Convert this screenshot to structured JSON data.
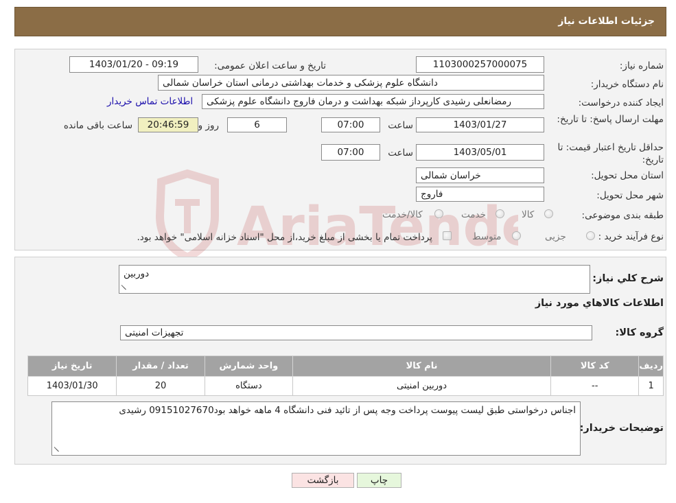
{
  "header": {
    "title": "جزئیات اطلاعات نیاز"
  },
  "details": {
    "need_number_label": "شماره نیاز:",
    "need_number": "1103000257000075",
    "announce_label": "تاریخ و ساعت اعلان عمومی:",
    "announce_value": "1403/01/20 - 09:19",
    "buyer_org_label": "نام دستگاه خریدار:",
    "buyer_org": "دانشگاه علوم پزشکی و خدمات بهداشتی درمانی استان خراسان شمالی",
    "creator_label": "ایجاد کننده درخواست:",
    "creator": "رمضانعلی رشیدی کارپرداز شبکه بهداشت و درمان فاروج دانشگاه علوم پزشکی",
    "contact_link": "اطلاعات تماس خریدار",
    "deadline_label": "مهلت ارسال پاسخ: تا تاریخ:",
    "deadline_date": "1403/01/27",
    "time_label": "ساعت",
    "deadline_time": "07:00",
    "days_value": "6",
    "days_label": "روز و",
    "remaining_time": "20:46:59",
    "remaining_label": "ساعت باقی مانده",
    "validity_label": "حداقل تاریخ اعتبار قیمت: تا تاریخ:",
    "validity_date": "1403/05/01",
    "validity_time_label": "ساعت",
    "validity_time": "07:00",
    "province_label": "استان محل تحویل:",
    "province": "خراسان شمالی",
    "city_label": "شهر محل تحویل:",
    "city": "فاروج",
    "category_label": "طبقه بندی موضوعی:",
    "category_options": [
      "کالا",
      "خدمت",
      "کالا/خدمت"
    ],
    "process_label": "نوع فرآیند خرید :",
    "process_options": [
      "جزیی",
      "متوسط"
    ],
    "process_note": "پرداخت تمام یا بخشی از مبلغ خرید،از محل \"اسناد خزانه اسلامی\" خواهد بود."
  },
  "description": {
    "label": "شرح کلي نياز:",
    "value": "دوربین",
    "goods_heading": "اطلاعات کالاهاي مورد نياز",
    "group_label": "گروه کالا:",
    "group_value": "تجهیزات امنیتی"
  },
  "table": {
    "headers": [
      "ردیف",
      "کد کالا",
      "نام کالا",
      "واحد شمارش",
      "تعداد / مقدار",
      "تاریخ نیاز"
    ],
    "rows": [
      [
        "1",
        "--",
        "دوربین امنیتی",
        "دستگاه",
        "20",
        "1403/01/30"
      ]
    ]
  },
  "buyer_notes": {
    "label": "توضیحات خریدار:",
    "value": "اجناس درخواستی طبق لیست پیوست پرداخت وجه پس از تائید فنی دانشگاه 4 ماهه خواهد بود09151027670 رشیدی"
  },
  "buttons": {
    "print": "چاپ",
    "back": "بازگشت"
  },
  "watermark": "AriaTender.neT",
  "colors": {
    "header_bg": "#8b6d46",
    "link": "#1a0dab",
    "print_bg": "#e6f7dc",
    "back_bg": "#fbe3e3",
    "table_header": "#a3a3a3"
  }
}
